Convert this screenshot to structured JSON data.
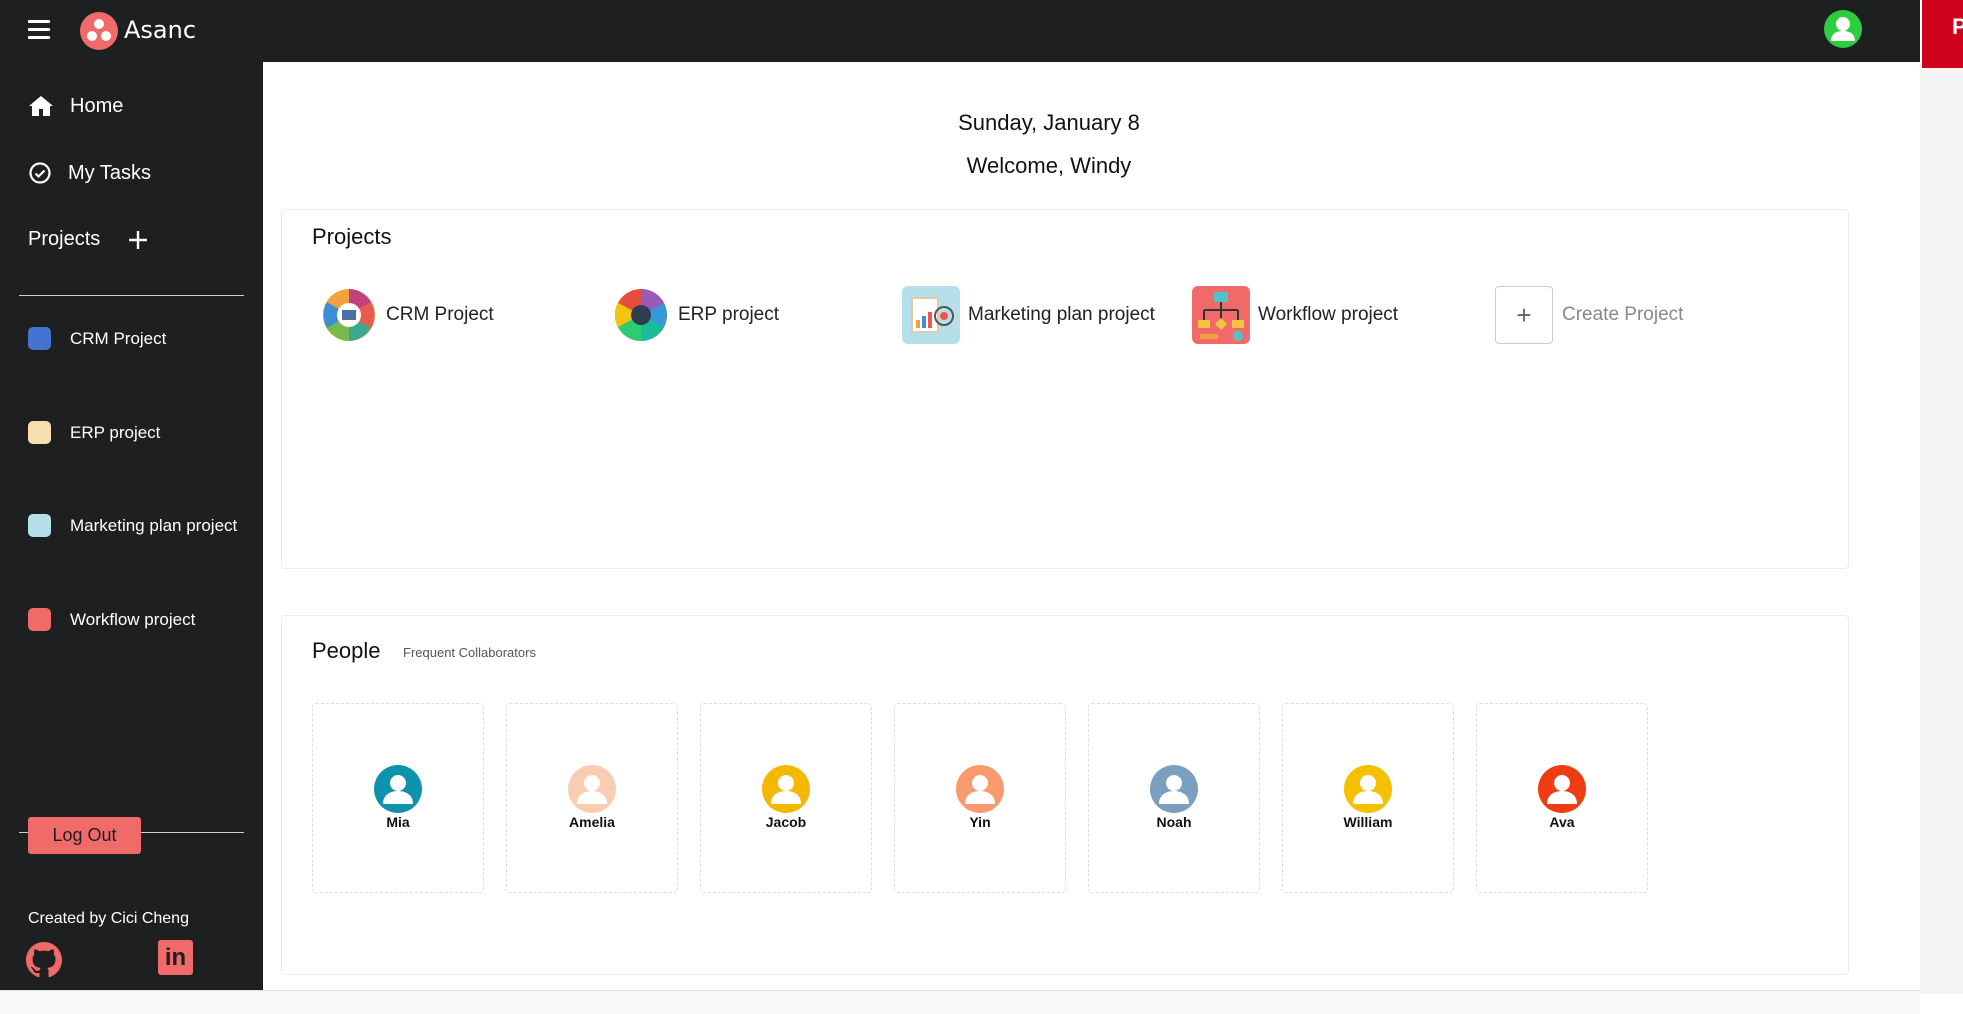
{
  "app": {
    "brand": "Asanc",
    "corner_label": "P"
  },
  "sidebar": {
    "nav": [
      {
        "label": "Home",
        "icon": "home-icon"
      },
      {
        "label": "My Tasks",
        "icon": "check-circle-icon"
      }
    ],
    "projects_heading": "Projects",
    "projects": [
      {
        "label": "CRM Project",
        "color": "#4573d2"
      },
      {
        "label": "ERP project",
        "color": "#f8dfb0"
      },
      {
        "label": "Marketing plan project",
        "color": "#b6e0e9"
      },
      {
        "label": "Workflow project",
        "color": "#f06a6a"
      }
    ],
    "logout_label": "Log Out",
    "credit": "Created by Cici Cheng"
  },
  "main": {
    "date": "Sunday, January 8",
    "welcome": "Welcome, Windy",
    "projects_card": {
      "title": "Projects",
      "items": [
        {
          "name": "CRM Project"
        },
        {
          "name": "ERP project"
        },
        {
          "name": "Marketing plan project"
        },
        {
          "name": "Workflow project"
        }
      ],
      "create_label": "Create Project"
    },
    "people_card": {
      "title": "People",
      "subtitle": "Frequent Collaborators",
      "people": [
        {
          "name": "Mia",
          "color": "#0f93ac"
        },
        {
          "name": "Amelia",
          "color": "#f8cdb2"
        },
        {
          "name": "Jacob",
          "color": "#f5b800"
        },
        {
          "name": "Yin",
          "color": "#f89a6d"
        },
        {
          "name": "Noah",
          "color": "#7a9fbf"
        },
        {
          "name": "William",
          "color": "#f5c000"
        },
        {
          "name": "Ava",
          "color": "#f03c12"
        }
      ]
    }
  },
  "colors": {
    "accent": "#f06a6a",
    "sidebar_bg": "#1e1f21",
    "user_avatar": "#2ecc40"
  }
}
